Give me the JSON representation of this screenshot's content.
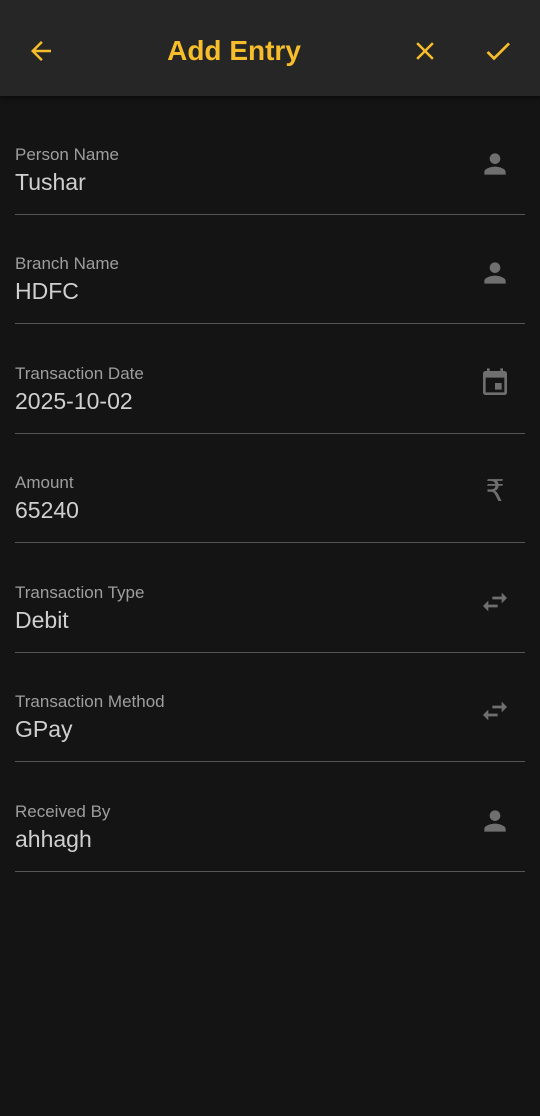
{
  "header": {
    "title": "Add Entry",
    "back_icon": "arrow-back-icon",
    "close_icon": "close-icon",
    "done_icon": "check-icon",
    "accent_color": "#f7bd2a"
  },
  "fields": [
    {
      "label": "Person Name",
      "value": "Tushar",
      "icon": "person-icon"
    },
    {
      "label": "Branch Name",
      "value": "HDFC",
      "icon": "person-icon"
    },
    {
      "label": "Transaction Date",
      "value": "2025-10-02",
      "icon": "calendar-icon"
    },
    {
      "label": "Amount",
      "value": "65240",
      "icon": "rupee-icon",
      "icon_glyph": "₹"
    },
    {
      "label": "Transaction Type",
      "value": "Debit",
      "icon": "swap-icon"
    },
    {
      "label": "Transaction Method",
      "value": "GPay",
      "icon": "swap-icon"
    },
    {
      "label": "Received By",
      "value": "ahhagh",
      "icon": "person-icon"
    }
  ]
}
